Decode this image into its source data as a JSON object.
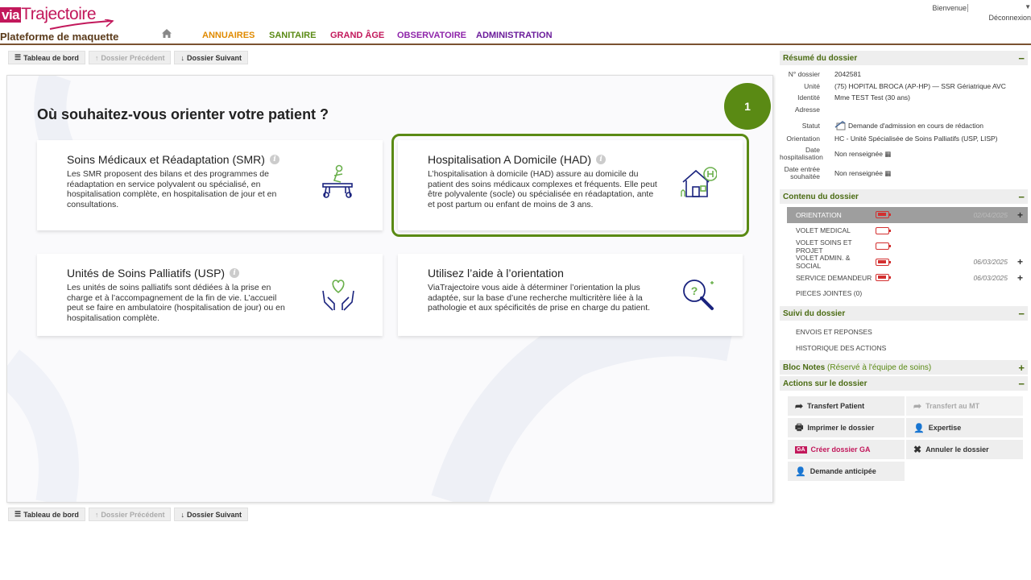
{
  "header": {
    "logo_via": "via",
    "logo_text": "Trajectoire",
    "platform": "Plateforme de maquette",
    "welcome": "Bienvenue",
    "logout": "Déconnexion",
    "nav": [
      {
        "label": "ANNUAIRES",
        "color": "#e08a00"
      },
      {
        "label": "SANITAIRE",
        "color": "#5a8a14"
      },
      {
        "label": "GRAND ÂGE",
        "color": "#c2185b"
      },
      {
        "label": "OBSERVATOIRE",
        "color": "#8e24aa"
      },
      {
        "label": "ADMINISTRATION",
        "color": "#6a1b9a"
      }
    ]
  },
  "toolbar": {
    "dashboard": "Tableau de bord",
    "previous": "Dossier Précédent",
    "next": "Dossier Suivant"
  },
  "main": {
    "title": "Où souhaitez-vous orienter votre patient ?",
    "step": "1",
    "cards": [
      {
        "title": "Soins Médicaux et Réadaptation (SMR)",
        "desc": "Les SMR proposent des bilans et des programmes de réadaptation en service polyvalent ou spécialisé, en hospitalisation complète, en hospitalisation de jour et en consultations."
      },
      {
        "title": "Hospitalisation A Domicile (HAD)",
        "desc": "L’hospitalisation à domicile (HAD) assure au domicile du patient des soins médicaux complexes et fréquents. Elle peut être polyvalente (socle) ou spécialisée en réadaptation, ante et post partum ou enfant de moins de 3 ans."
      },
      {
        "title": "Unités de Soins Palliatifs (USP)",
        "desc": "Les unités de soins palliatifs sont dédiées à la prise en charge et à l’accompagnement de la fin de vie. L’accueil peut se faire en ambulatoire (hospitalisation de jour) ou en hospitalisation complète."
      },
      {
        "title": "Utilisez l’aide à l’orientation",
        "desc": "ViaTrajectoire vous aide à déterminer l’orientation la plus adaptée, sur la base d’une recherche multicritère liée à la pathologie et aux spécificités de prise en charge du patient."
      }
    ]
  },
  "sidebar": {
    "summary": {
      "title": "Résumé du dossier",
      "rows": [
        {
          "k": "N° dossier",
          "v": "2042581"
        },
        {
          "k": "Unité",
          "v": "(75) HOPITAL BROCA (AP-HP) — SSR Gériatrique AVC"
        },
        {
          "k": "Identité",
          "v": "Mme TEST Test (30 ans)"
        },
        {
          "k": "Adresse",
          "v": ""
        },
        {
          "k": "Statut",
          "v": "Demande d'admission en cours de rédaction"
        },
        {
          "k": "Orientation",
          "v": "HC - Unité Spécialisée de Soins Palliatifs (USP, LISP)"
        },
        {
          "k": "Date hospitalisation",
          "v": "Non renseignée"
        },
        {
          "k": "Date entrée souhaitée",
          "v": "Non renseignée"
        }
      ]
    },
    "content": {
      "title": "Contenu du dossier",
      "items": [
        {
          "label": "ORIENTATION",
          "date": "02/04/2025",
          "full": true
        },
        {
          "label": "VOLET MEDICAL",
          "date": "",
          "full": false
        },
        {
          "label": "VOLET SOINS ET PROJET",
          "date": "",
          "full": false
        },
        {
          "label": "VOLET ADMIN. & SOCIAL",
          "date": "06/03/2025",
          "full": true
        },
        {
          "label": "SERVICE DEMANDEUR",
          "date": "06/03/2025",
          "full": true
        },
        {
          "label": "PIECES JOINTES (0)",
          "date": "",
          "full": false
        }
      ]
    },
    "followup": {
      "title": "Suivi du dossier",
      "items": [
        "ENVOIS ET REPONSES",
        "HISTORIQUE DES ACTIONS"
      ]
    },
    "notes": {
      "title": "Bloc Notes",
      "sub": "(Réservé à l'équipe de soins)"
    },
    "actions": {
      "title": "Actions sur le dossier",
      "transfer": "Transfert Patient",
      "transfer_mt": "Transfert au MT",
      "print": "Imprimer le dossier",
      "expertise": "Expertise",
      "create_ga": "Créer dossier GA",
      "ga_badge": "GA",
      "cancel": "Annuler le dossier",
      "anticipated": "Demande anticipée"
    }
  },
  "colors": {
    "accent_green": "#5a8a14",
    "brand_pink": "#c2185b",
    "navy_icon": "#1a237e"
  }
}
